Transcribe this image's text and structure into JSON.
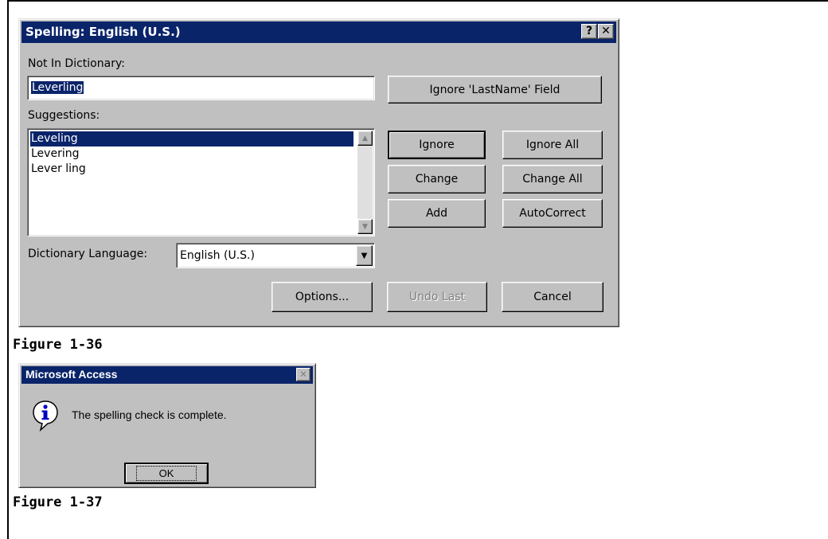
{
  "spelling_dialog": {
    "title": "Spelling: English (U.S.)",
    "help_glyph": "?",
    "close_glyph": "✕",
    "not_in_dictionary_label": "Not In Dictionary:",
    "not_in_dictionary_value": "Leverling",
    "ignore_field_button": "Ignore 'LastName' Field",
    "suggestions_label": "Suggestions:",
    "suggestions": [
      "Leveling",
      "Levering",
      "Lever ling"
    ],
    "selected_suggestion": 0,
    "buttons": {
      "ignore": "Ignore",
      "ignore_all": "Ignore All",
      "change": "Change",
      "change_all": "Change All",
      "add": "Add",
      "autocorrect": "AutoCorrect",
      "options": "Options...",
      "undo_last": "Undo Last",
      "cancel": "Cancel"
    },
    "dictionary_language_label": "Dictionary Language:",
    "dictionary_language_value": "English (U.S.)"
  },
  "figure_1": "Figure 1-36",
  "message_box": {
    "title": "Microsoft Access",
    "close_glyph": "✕",
    "message": "The spelling check is complete.",
    "ok_label": "OK",
    "icon": "information-icon"
  },
  "figure_2": "Figure 1-37",
  "colors": {
    "titlebar": "#0a246a",
    "dialog_face": "#c0c0c0",
    "selection": "#0a246a"
  }
}
